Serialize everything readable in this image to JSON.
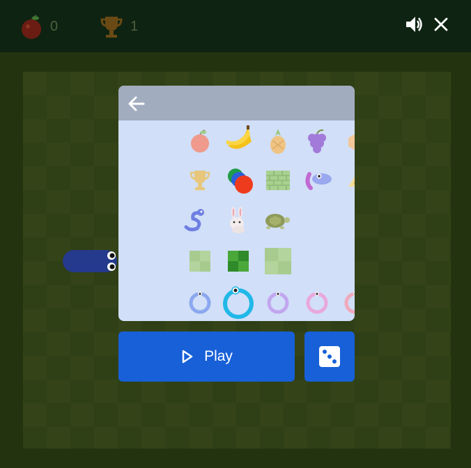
{
  "scores": {
    "apples": "0",
    "best": "1"
  },
  "icons": {
    "apple": "apple-icon",
    "trophy": "trophy-icon",
    "sound": "speaker-icon",
    "close": "close-icon",
    "back": "back-arrow-icon",
    "play": "play-icon",
    "dice": "dice-icon"
  },
  "menu": {
    "rows": [
      {
        "kind": "food",
        "items": [
          "apple",
          "banana",
          "pineapple",
          "grapes",
          "cheese"
        ]
      },
      {
        "kind": "goal",
        "items": [
          "trophy",
          "balls",
          "wall",
          "snake-toy",
          "cheese"
        ]
      },
      {
        "kind": "animal",
        "items": [
          "snake",
          "rabbit",
          "turtle"
        ]
      },
      {
        "kind": "size",
        "items": [
          "small",
          "medium",
          "large"
        ]
      },
      {
        "kind": "color",
        "items": [
          "blue",
          "cyan",
          "purple",
          "pink",
          "rose"
        ]
      }
    ]
  },
  "buttons": {
    "play_label": "Play"
  },
  "colors": {
    "accent": "#1760d8",
    "panel": "#d1dff8",
    "header": "#a1acbf",
    "snake": "#253a8c"
  }
}
